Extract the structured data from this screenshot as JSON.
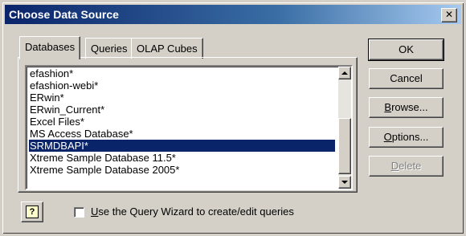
{
  "window": {
    "title": "Choose Data Source",
    "close_symbol": "✕"
  },
  "tabs": [
    {
      "label": "Databases",
      "active": true
    },
    {
      "label": "Queries",
      "active": false
    },
    {
      "label": "OLAP Cubes",
      "active": false
    }
  ],
  "list": {
    "items": [
      "efashion*",
      "efashion-webi*",
      "ERwin*",
      "ERwin_Current*",
      "Excel Files*",
      "MS Access Database*",
      "SRMDBAPI*",
      "Xtreme Sample Database 11.5*",
      "Xtreme Sample Database 2005*"
    ],
    "selected_index": 6
  },
  "buttons": {
    "ok": "OK",
    "cancel": "Cancel",
    "browse_mnemonic": "B",
    "browse_rest": "rowse...",
    "options_mnemonic": "O",
    "options_rest": "ptions...",
    "delete_mnemonic": "D",
    "delete_rest": "elete"
  },
  "wizard": {
    "checked": false,
    "label_mnemonic": "U",
    "label_rest": "se the Query Wizard to create/edit queries"
  },
  "icons": {
    "help": "help-question-icon",
    "scroll_up": "arrow-up-icon",
    "scroll_down": "arrow-down-icon"
  },
  "help_glyph": "?"
}
